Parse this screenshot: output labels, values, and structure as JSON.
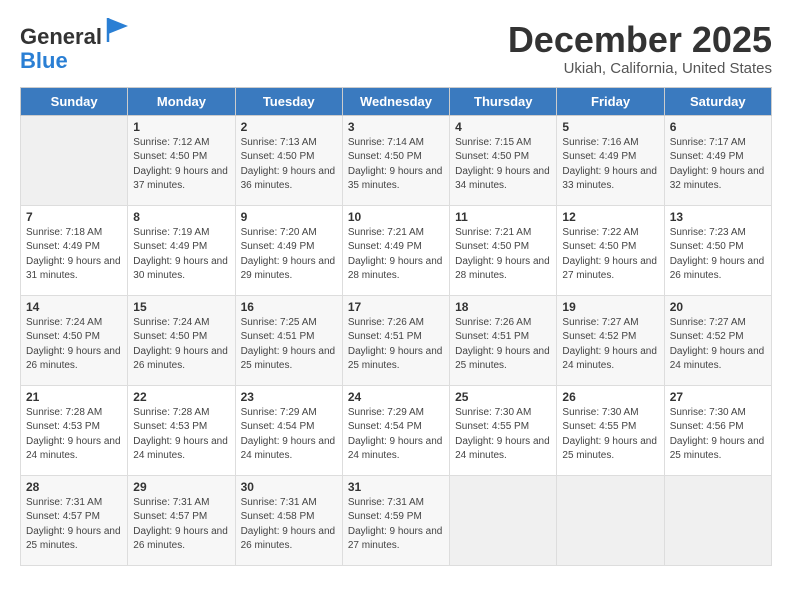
{
  "header": {
    "logo_line1": "General",
    "logo_line2": "Blue",
    "month_title": "December 2025",
    "subtitle": "Ukiah, California, United States"
  },
  "days_of_week": [
    "Sunday",
    "Monday",
    "Tuesday",
    "Wednesday",
    "Thursday",
    "Friday",
    "Saturday"
  ],
  "weeks": [
    [
      {
        "day": "",
        "sunrise": "",
        "sunset": "",
        "daylight": ""
      },
      {
        "day": "1",
        "sunrise": "Sunrise: 7:12 AM",
        "sunset": "Sunset: 4:50 PM",
        "daylight": "Daylight: 9 hours and 37 minutes."
      },
      {
        "day": "2",
        "sunrise": "Sunrise: 7:13 AM",
        "sunset": "Sunset: 4:50 PM",
        "daylight": "Daylight: 9 hours and 36 minutes."
      },
      {
        "day": "3",
        "sunrise": "Sunrise: 7:14 AM",
        "sunset": "Sunset: 4:50 PM",
        "daylight": "Daylight: 9 hours and 35 minutes."
      },
      {
        "day": "4",
        "sunrise": "Sunrise: 7:15 AM",
        "sunset": "Sunset: 4:50 PM",
        "daylight": "Daylight: 9 hours and 34 minutes."
      },
      {
        "day": "5",
        "sunrise": "Sunrise: 7:16 AM",
        "sunset": "Sunset: 4:49 PM",
        "daylight": "Daylight: 9 hours and 33 minutes."
      },
      {
        "day": "6",
        "sunrise": "Sunrise: 7:17 AM",
        "sunset": "Sunset: 4:49 PM",
        "daylight": "Daylight: 9 hours and 32 minutes."
      }
    ],
    [
      {
        "day": "7",
        "sunrise": "Sunrise: 7:18 AM",
        "sunset": "Sunset: 4:49 PM",
        "daylight": "Daylight: 9 hours and 31 minutes."
      },
      {
        "day": "8",
        "sunrise": "Sunrise: 7:19 AM",
        "sunset": "Sunset: 4:49 PM",
        "daylight": "Daylight: 9 hours and 30 minutes."
      },
      {
        "day": "9",
        "sunrise": "Sunrise: 7:20 AM",
        "sunset": "Sunset: 4:49 PM",
        "daylight": "Daylight: 9 hours and 29 minutes."
      },
      {
        "day": "10",
        "sunrise": "Sunrise: 7:21 AM",
        "sunset": "Sunset: 4:49 PM",
        "daylight": "Daylight: 9 hours and 28 minutes."
      },
      {
        "day": "11",
        "sunrise": "Sunrise: 7:21 AM",
        "sunset": "Sunset: 4:50 PM",
        "daylight": "Daylight: 9 hours and 28 minutes."
      },
      {
        "day": "12",
        "sunrise": "Sunrise: 7:22 AM",
        "sunset": "Sunset: 4:50 PM",
        "daylight": "Daylight: 9 hours and 27 minutes."
      },
      {
        "day": "13",
        "sunrise": "Sunrise: 7:23 AM",
        "sunset": "Sunset: 4:50 PM",
        "daylight": "Daylight: 9 hours and 26 minutes."
      }
    ],
    [
      {
        "day": "14",
        "sunrise": "Sunrise: 7:24 AM",
        "sunset": "Sunset: 4:50 PM",
        "daylight": "Daylight: 9 hours and 26 minutes."
      },
      {
        "day": "15",
        "sunrise": "Sunrise: 7:24 AM",
        "sunset": "Sunset: 4:50 PM",
        "daylight": "Daylight: 9 hours and 26 minutes."
      },
      {
        "day": "16",
        "sunrise": "Sunrise: 7:25 AM",
        "sunset": "Sunset: 4:51 PM",
        "daylight": "Daylight: 9 hours and 25 minutes."
      },
      {
        "day": "17",
        "sunrise": "Sunrise: 7:26 AM",
        "sunset": "Sunset: 4:51 PM",
        "daylight": "Daylight: 9 hours and 25 minutes."
      },
      {
        "day": "18",
        "sunrise": "Sunrise: 7:26 AM",
        "sunset": "Sunset: 4:51 PM",
        "daylight": "Daylight: 9 hours and 25 minutes."
      },
      {
        "day": "19",
        "sunrise": "Sunrise: 7:27 AM",
        "sunset": "Sunset: 4:52 PM",
        "daylight": "Daylight: 9 hours and 24 minutes."
      },
      {
        "day": "20",
        "sunrise": "Sunrise: 7:27 AM",
        "sunset": "Sunset: 4:52 PM",
        "daylight": "Daylight: 9 hours and 24 minutes."
      }
    ],
    [
      {
        "day": "21",
        "sunrise": "Sunrise: 7:28 AM",
        "sunset": "Sunset: 4:53 PM",
        "daylight": "Daylight: 9 hours and 24 minutes."
      },
      {
        "day": "22",
        "sunrise": "Sunrise: 7:28 AM",
        "sunset": "Sunset: 4:53 PM",
        "daylight": "Daylight: 9 hours and 24 minutes."
      },
      {
        "day": "23",
        "sunrise": "Sunrise: 7:29 AM",
        "sunset": "Sunset: 4:54 PM",
        "daylight": "Daylight: 9 hours and 24 minutes."
      },
      {
        "day": "24",
        "sunrise": "Sunrise: 7:29 AM",
        "sunset": "Sunset: 4:54 PM",
        "daylight": "Daylight: 9 hours and 24 minutes."
      },
      {
        "day": "25",
        "sunrise": "Sunrise: 7:30 AM",
        "sunset": "Sunset: 4:55 PM",
        "daylight": "Daylight: 9 hours and 24 minutes."
      },
      {
        "day": "26",
        "sunrise": "Sunrise: 7:30 AM",
        "sunset": "Sunset: 4:55 PM",
        "daylight": "Daylight: 9 hours and 25 minutes."
      },
      {
        "day": "27",
        "sunrise": "Sunrise: 7:30 AM",
        "sunset": "Sunset: 4:56 PM",
        "daylight": "Daylight: 9 hours and 25 minutes."
      }
    ],
    [
      {
        "day": "28",
        "sunrise": "Sunrise: 7:31 AM",
        "sunset": "Sunset: 4:57 PM",
        "daylight": "Daylight: 9 hours and 25 minutes."
      },
      {
        "day": "29",
        "sunrise": "Sunrise: 7:31 AM",
        "sunset": "Sunset: 4:57 PM",
        "daylight": "Daylight: 9 hours and 26 minutes."
      },
      {
        "day": "30",
        "sunrise": "Sunrise: 7:31 AM",
        "sunset": "Sunset: 4:58 PM",
        "daylight": "Daylight: 9 hours and 26 minutes."
      },
      {
        "day": "31",
        "sunrise": "Sunrise: 7:31 AM",
        "sunset": "Sunset: 4:59 PM",
        "daylight": "Daylight: 9 hours and 27 minutes."
      },
      {
        "day": "",
        "sunrise": "",
        "sunset": "",
        "daylight": ""
      },
      {
        "day": "",
        "sunrise": "",
        "sunset": "",
        "daylight": ""
      },
      {
        "day": "",
        "sunrise": "",
        "sunset": "",
        "daylight": ""
      }
    ]
  ]
}
